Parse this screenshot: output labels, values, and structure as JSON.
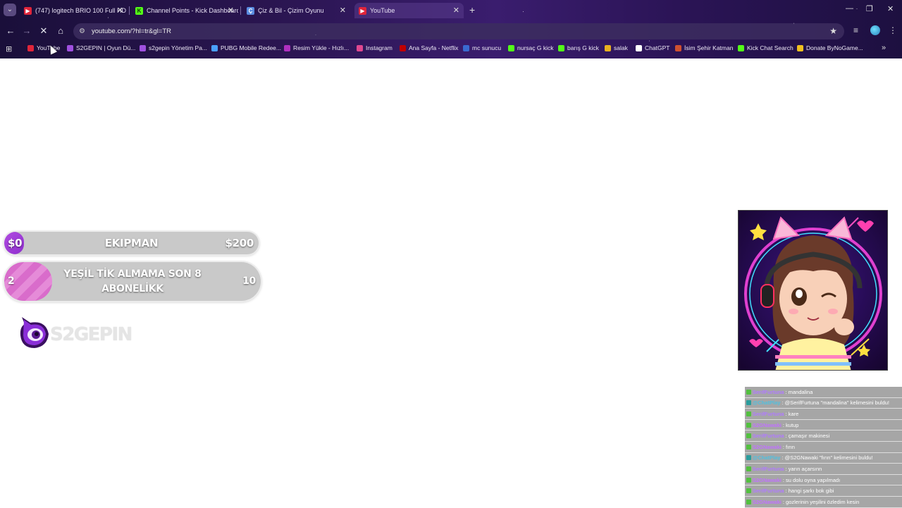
{
  "tabs": [
    {
      "title": "(747) logitech BRIO 100 Full HD",
      "favicon": "youtube-favicon",
      "color": "#e0253a",
      "active": false
    },
    {
      "title": "Channel Points - Kick Dashboard",
      "favicon": "kick-favicon",
      "color": "#53fc18",
      "active": false
    },
    {
      "title": "Çiz & Bil - Çizim Oyunu",
      "favicon": "drawing-game-favicon",
      "color": "#5a8ce0",
      "active": false
    },
    {
      "title": "YouTube",
      "favicon": "youtube-favicon",
      "color": "#e0253a",
      "active": true
    }
  ],
  "toolbar": {
    "url": "youtube.com/?hl=tr&gl=TR"
  },
  "bookmarks": [
    {
      "label": "YouTube",
      "color": "#e0253a"
    },
    {
      "label": "S2GEPIN | Oyun Dü...",
      "color": "#a050e0"
    },
    {
      "label": "s2gepin Yönetim Pa...",
      "color": "#a050e0"
    },
    {
      "label": "PUBG Mobile Redee...",
      "color": "#4aa0ff"
    },
    {
      "label": "Resim Yükle - Hızlı...",
      "color": "#b030c0"
    },
    {
      "label": "Instagram",
      "color": "#e04890"
    },
    {
      "label": "Ana Sayfa - Netflix",
      "color": "#c00000"
    },
    {
      "label": "mc sunucu",
      "color": "#3a6ad0"
    },
    {
      "label": "nursaç G kick",
      "color": "#53fc18"
    },
    {
      "label": "barış G kick",
      "color": "#53fc18"
    },
    {
      "label": "salak",
      "color": "#e8b020"
    },
    {
      "label": "ChatGPT",
      "color": "#ffffff"
    },
    {
      "label": "İsim Şehir Katman",
      "color": "#d05030"
    },
    {
      "label": "Kick Chat Search",
      "color": "#53fc18"
    },
    {
      "label": "Donate ByNoGame...",
      "color": "#f0c020"
    }
  ],
  "goals": {
    "equipment": {
      "current": "$0",
      "title": "EKIPMAN",
      "target": "$200",
      "progress": 0
    },
    "subs": {
      "current": "2",
      "title_line1": "YEŞİL TİK ALMAMA SON 8",
      "title_line2": "ABONELİKK",
      "target": "10",
      "progress": 0.2
    }
  },
  "logo_text": "S2GEPIN",
  "chat": [
    {
      "user": "SerifFurtuna",
      "user_color": "#b07aff",
      "text": ": mandalina"
    },
    {
      "user": "@ChatPlay",
      "user_color": "#4fc0e0",
      "text": ": @SerifFurtuna \"mandalina\" kelimesini buldu!"
    },
    {
      "user": "SerifFurtuna",
      "user_color": "#b07aff",
      "text": ": kare"
    },
    {
      "user": "S2GNawaki",
      "user_color": "#c070ff",
      "text": ": kutup"
    },
    {
      "user": "SerifFurtuna",
      "user_color": "#b07aff",
      "text": ": çamaşır makinesi"
    },
    {
      "user": "S2GNawaki",
      "user_color": "#c070ff",
      "text": ": fırın"
    },
    {
      "user": "@ChatPlay",
      "user_color": "#4fc0e0",
      "text": ": @S2GNawaki \"fırın\" kelimesini buldu!"
    },
    {
      "user": "SerifFurtuna",
      "user_color": "#b07aff",
      "text": ": yarın açarsınn"
    },
    {
      "user": "S2GNawaki",
      "user_color": "#c070ff",
      "text": ": su dolu oyna yapılmadı"
    },
    {
      "user": "SerifFurtuna",
      "user_color": "#b07aff",
      "text": ": hangi şarkı bok gibi"
    },
    {
      "user": "S2GNawaki",
      "user_color": "#c070ff",
      "text": ": gozlerinin yeşilini özledim kesin"
    }
  ]
}
